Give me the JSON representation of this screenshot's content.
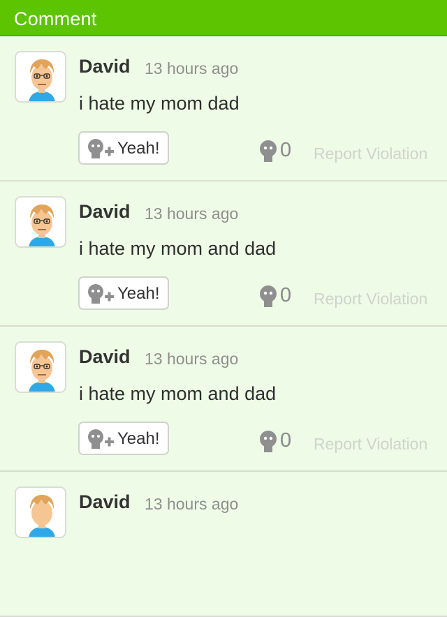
{
  "header": {
    "title": "Comment"
  },
  "comments": [
    {
      "author": "David",
      "time": "13 hours ago",
      "text": "i hate my mom dad",
      "yeah_label": "Yeah!",
      "empathy_count": "0",
      "report_label": "Report Violation"
    },
    {
      "author": "David",
      "time": "13 hours ago",
      "text": "i hate my mom and dad",
      "yeah_label": "Yeah!",
      "empathy_count": "0",
      "report_label": "Report Violation"
    },
    {
      "author": "David",
      "time": "13 hours ago",
      "text": "i hate my mom and dad",
      "yeah_label": "Yeah!",
      "empathy_count": "0",
      "report_label": "Report Violation"
    },
    {
      "author": "David",
      "time": "13 hours ago"
    }
  ],
  "colors": {
    "header_bg": "#5cc400",
    "page_bg": "#eefbe6",
    "muted_text": "#8f8f8f",
    "report_text": "#cfd4cc"
  },
  "icons": {
    "avatar": "mii-avatar-icon",
    "yeah": "empathy-add-icon",
    "empathy": "empathy-face-icon"
  }
}
